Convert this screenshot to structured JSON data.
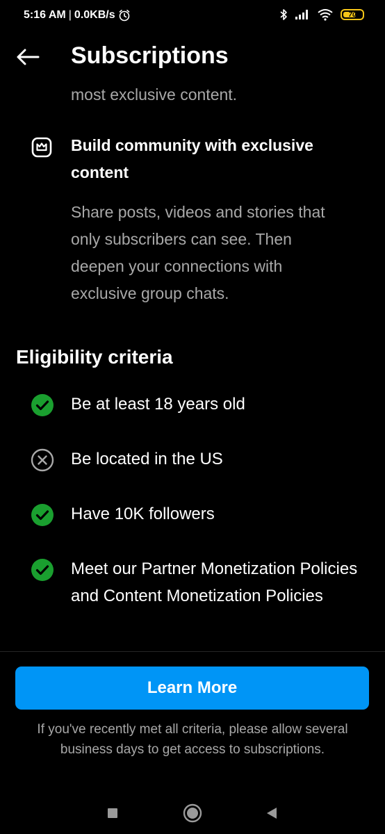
{
  "status_bar": {
    "time": "5:16 AM",
    "separator": "|",
    "network_speed": "0.0KB/s",
    "battery_level": "70",
    "battery_percent": 70,
    "icons": [
      "alarm-icon",
      "bluetooth-icon",
      "signal-icon",
      "wifi-icon",
      "battery-icon"
    ]
  },
  "header": {
    "title": "Subscriptions",
    "back_icon": "arrow-left-icon"
  },
  "content": {
    "partial_text": "most exclusive content.",
    "feature": {
      "icon": "crown-icon",
      "title": "Build community with exclusive content",
      "description": "Share posts, videos and stories that only subscribers can see. Then deepen your connections with exclusive group chats."
    },
    "eligibility": {
      "heading": "Eligibility criteria",
      "items": [
        {
          "label": "Be at least 18 years old",
          "met": true,
          "icon": "check-circle-icon"
        },
        {
          "label": "Be located in the US",
          "met": false,
          "icon": "x-circle-icon"
        },
        {
          "label": "Have 10K followers",
          "met": true,
          "icon": "check-circle-icon"
        },
        {
          "label": "Meet our Partner Monetization Policies and Content Monetization Policies",
          "met": true,
          "icon": "check-circle-icon"
        }
      ]
    }
  },
  "footer": {
    "button_label": "Learn More",
    "note": "If you've recently met all criteria, please allow several business days to get access to subscriptions."
  },
  "nav_bar": {
    "icons": [
      "recents-square-icon",
      "home-circle-icon",
      "back-triangle-icon"
    ]
  },
  "colors": {
    "background": "#000000",
    "accent": "#0095f6",
    "success": "#1a9f2f",
    "secondary_text": "#a8a8a8",
    "battery": "#f5c518"
  }
}
